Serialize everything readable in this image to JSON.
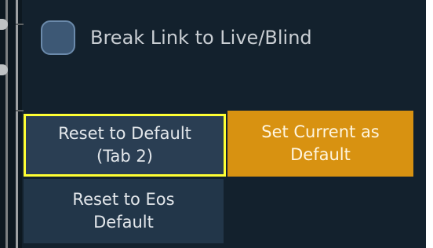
{
  "options": {
    "break_link_label": "Break Link to Live/Blind",
    "break_link_checked": false
  },
  "buttons": {
    "reset_default": {
      "line1": "Reset to Default",
      "line2": "(Tab 2)"
    },
    "set_current": {
      "line1": "Set Current as",
      "line2": "Default"
    },
    "reset_eos": {
      "line1": "Reset to Eos",
      "line2": "Default"
    }
  },
  "colors": {
    "background": "#13212d",
    "checkbox_fill": "#3d5875",
    "button_fill": "#2a3e53",
    "accent_button": "#d89211",
    "focus_outline": "#ffff33"
  }
}
